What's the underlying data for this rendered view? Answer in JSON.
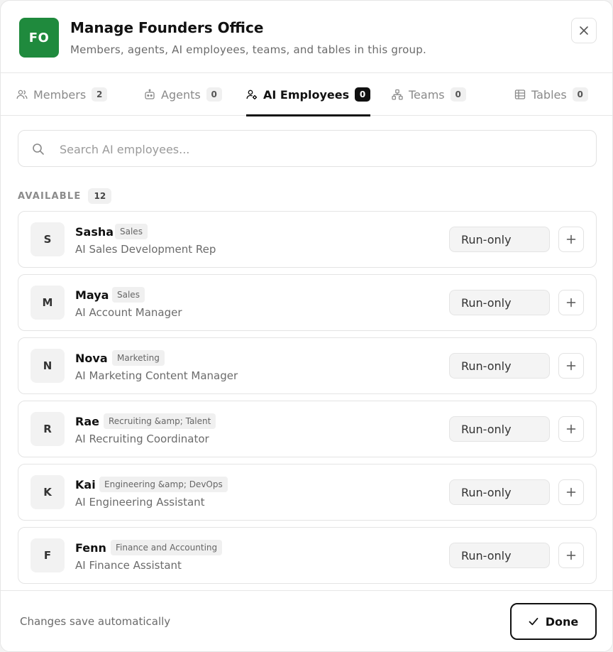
{
  "header": {
    "avatar_initials": "FO",
    "avatar_color": "#1f8a3d",
    "title": "Manage Founders Office",
    "subtitle": "Members, agents, AI employees, teams, and tables in this group."
  },
  "tabs": [
    {
      "label": "Members",
      "count": "2",
      "icon": "users-icon",
      "active": false
    },
    {
      "label": "Agents",
      "count": "0",
      "icon": "bot-icon",
      "active": false
    },
    {
      "label": "AI Employees",
      "count": "0",
      "icon": "user-cog-icon",
      "active": true
    },
    {
      "label": "Teams",
      "count": "0",
      "icon": "network-icon",
      "active": false
    },
    {
      "label": "Tables",
      "count": "0",
      "icon": "table-icon",
      "active": false
    }
  ],
  "search": {
    "placeholder": "Search AI employees..."
  },
  "available": {
    "label": "AVAILABLE",
    "count": "12"
  },
  "employees": [
    {
      "initial": "S",
      "name": "Sasha",
      "tag": "Sales",
      "role": "AI Sales Development Rep",
      "permission": "Run-only"
    },
    {
      "initial": "M",
      "name": "Maya",
      "tag": "Sales",
      "role": "AI Account Manager",
      "permission": "Run-only"
    },
    {
      "initial": "N",
      "name": "Nova",
      "tag": "Marketing",
      "role": "AI Marketing Content Manager",
      "permission": "Run-only"
    },
    {
      "initial": "R",
      "name": "Rae",
      "tag": "Recruiting &amp; Talent",
      "role": "AI Recruiting Coordinator",
      "permission": "Run-only"
    },
    {
      "initial": "K",
      "name": "Kai",
      "tag": "Engineering &amp; DevOps",
      "role": "AI Engineering Assistant",
      "permission": "Run-only"
    },
    {
      "initial": "F",
      "name": "Fenn",
      "tag": "Finance and Accounting",
      "role": "AI Finance Assistant",
      "permission": "Run-only"
    }
  ],
  "footer": {
    "note": "Changes save automatically",
    "done_label": "Done"
  }
}
